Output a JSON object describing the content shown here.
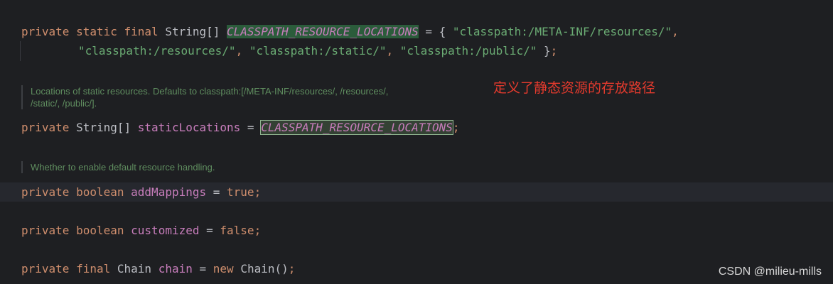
{
  "code": {
    "line1": {
      "kw1": "private",
      "kw2": "static",
      "kw3": "final",
      "type": "String[]",
      "name": "CLASSPATH_RESOURCE_LOCATIONS",
      "eq": " = { ",
      "s1": "\"classpath:/META-INF/resources/\"",
      "comma": ","
    },
    "line2": {
      "s2": "\"classpath:/resources/\"",
      "c1": ", ",
      "s3": "\"classpath:/static/\"",
      "c2": ", ",
      "s4": "\"classpath:/public/\"",
      "close": " }",
      "semi": ";"
    },
    "line3": {
      "kw1": "private",
      "type": "String[]",
      "name": "staticLocations",
      "eq": " = ",
      "value": "CLASSPATH_RESOURCE_LOCATIONS",
      "semi": ";"
    },
    "line4": {
      "kw1": "private",
      "kw2": "boolean",
      "name": "addMappings",
      "eq": " = ",
      "value": "true",
      "semi": ";"
    },
    "line5": {
      "kw1": "private",
      "kw2": "boolean",
      "name": "customized",
      "eq": " = ",
      "value": "false",
      "semi": ";"
    },
    "line6": {
      "kw1": "private",
      "kw2": "final",
      "type": "Chain",
      "name": "chain",
      "eq": " = ",
      "kw3": "new",
      "ctor": "Chain()",
      "semi": ";"
    }
  },
  "docs": {
    "static_locations_line1": "Locations of static resources. Defaults to classpath:[/META-INF/resources/, /resources/,",
    "static_locations_line2": "/static/, /public/].",
    "add_mappings": "Whether to enable default resource handling."
  },
  "annotation": "定义了静态资源的存放路径",
  "watermark": "CSDN @milieu-mills",
  "colors": {
    "background": "#1e1f22",
    "keyword": "#cf8e6d",
    "field": "#c77dbb",
    "string": "#6aab73",
    "doc_comment": "#5f8d5f",
    "annotation": "#e33a2d"
  }
}
